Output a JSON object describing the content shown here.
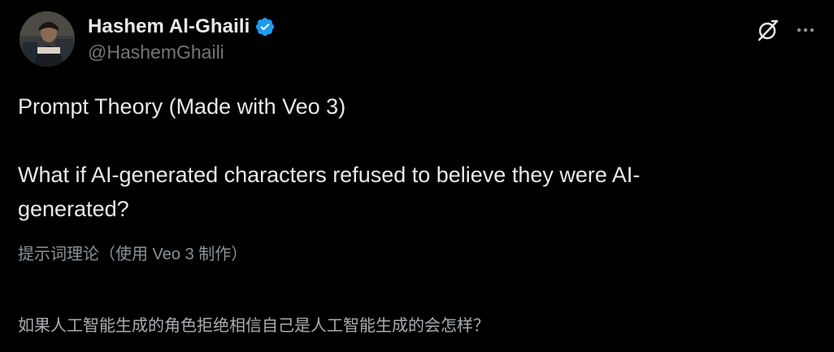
{
  "author": {
    "display_name": "Hashem Al-Ghaili",
    "handle": "@HashemGhaili",
    "verified": true,
    "verified_color": "#1d9bf0"
  },
  "actions": {
    "grok_icon": "grok-icon",
    "more_icon": "more-icon"
  },
  "post": {
    "line1": "Prompt Theory (Made with Veo 3)",
    "line2": "What if AI-generated characters refused to believe they were AI-generated?"
  },
  "translation": {
    "line1": "提示词理论（使用 Veo 3 制作）",
    "line2": "如果人工智能生成的角色拒绝相信自己是人工智能生成的会怎样？"
  },
  "colors": {
    "background": "#000000",
    "primary_text": "#e7e9ea",
    "secondary_text": "#71767b"
  }
}
